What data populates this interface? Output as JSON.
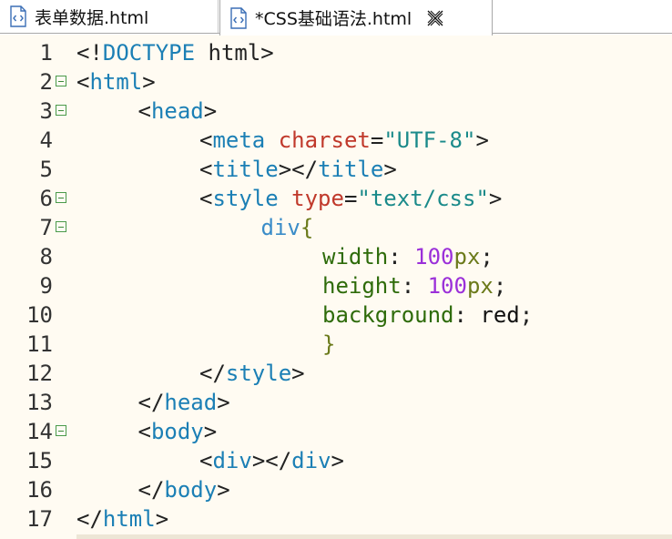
{
  "tabs": [
    {
      "label": "表单数据.html",
      "active": false,
      "icon": "html-file-icon"
    },
    {
      "label": "*CSS基础语法.html",
      "active": true,
      "icon": "html-file-icon",
      "close_icon": "close-icon"
    }
  ],
  "colors": {
    "tag": "#1b7fb5",
    "attribute": "#c0392b",
    "string": "#1a8a8a",
    "property": "#2e6b0a",
    "number": "#9b30d9",
    "unit": "#6b7a1a",
    "background": "#fffbf2"
  },
  "editor": {
    "lines": [
      {
        "num": "1",
        "fold": false,
        "indent": 0,
        "tokens": [
          [
            "punc",
            "<!"
          ],
          [
            "tag",
            "DOCTYPE"
          ],
          [
            "punc",
            " html>"
          ]
        ]
      },
      {
        "num": "2",
        "fold": true,
        "indent": 0,
        "tokens": [
          [
            "punc",
            "<"
          ],
          [
            "tag",
            "html"
          ],
          [
            "punc",
            ">"
          ]
        ]
      },
      {
        "num": "3",
        "fold": true,
        "indent": 1,
        "tokens": [
          [
            "punc",
            "<"
          ],
          [
            "tag",
            "head"
          ],
          [
            "punc",
            ">"
          ]
        ]
      },
      {
        "num": "4",
        "fold": false,
        "indent": 2,
        "tokens": [
          [
            "punc",
            "<"
          ],
          [
            "tag",
            "meta"
          ],
          [
            "punc",
            " "
          ],
          [
            "attr",
            "charset"
          ],
          [
            "punc",
            "="
          ],
          [
            "str",
            "\"UTF-8\""
          ],
          [
            "punc",
            ">"
          ]
        ]
      },
      {
        "num": "5",
        "fold": false,
        "indent": 2,
        "tokens": [
          [
            "punc",
            "<"
          ],
          [
            "tag",
            "title"
          ],
          [
            "punc",
            "></"
          ],
          [
            "tag",
            "title"
          ],
          [
            "punc",
            ">"
          ]
        ]
      },
      {
        "num": "6",
        "fold": true,
        "indent": 2,
        "tokens": [
          [
            "punc",
            "<"
          ],
          [
            "tag",
            "style"
          ],
          [
            "punc",
            " "
          ],
          [
            "attr",
            "type"
          ],
          [
            "punc",
            "="
          ],
          [
            "str",
            "\"text/css\""
          ],
          [
            "punc",
            ">"
          ]
        ]
      },
      {
        "num": "7",
        "fold": true,
        "indent": 3,
        "tokens": [
          [
            "sel",
            "div"
          ],
          [
            "brace",
            "{"
          ]
        ]
      },
      {
        "num": "8",
        "fold": false,
        "indent": 4,
        "tokens": [
          [
            "prop",
            "width"
          ],
          [
            "punc",
            ": "
          ],
          [
            "num",
            "100"
          ],
          [
            "unit",
            "px"
          ],
          [
            "punc",
            ";"
          ]
        ]
      },
      {
        "num": "9",
        "fold": false,
        "indent": 4,
        "tokens": [
          [
            "prop",
            "height"
          ],
          [
            "punc",
            ": "
          ],
          [
            "num",
            "100"
          ],
          [
            "unit",
            "px"
          ],
          [
            "punc",
            ";"
          ]
        ]
      },
      {
        "num": "10",
        "fold": false,
        "indent": 4,
        "tokens": [
          [
            "prop",
            "background"
          ],
          [
            "punc",
            ": "
          ],
          [
            "val",
            "red"
          ],
          [
            "punc",
            ";"
          ]
        ]
      },
      {
        "num": "11",
        "fold": false,
        "indent": 4,
        "tokens": [
          [
            "brace",
            "}"
          ]
        ]
      },
      {
        "num": "12",
        "fold": false,
        "indent": 2,
        "tokens": [
          [
            "punc",
            "</"
          ],
          [
            "tag",
            "style"
          ],
          [
            "punc",
            ">"
          ]
        ]
      },
      {
        "num": "13",
        "fold": false,
        "indent": 1,
        "tokens": [
          [
            "punc",
            "</"
          ],
          [
            "tag",
            "head"
          ],
          [
            "punc",
            ">"
          ]
        ]
      },
      {
        "num": "14",
        "fold": true,
        "indent": 1,
        "tokens": [
          [
            "punc",
            "<"
          ],
          [
            "tag",
            "body"
          ],
          [
            "punc",
            ">"
          ]
        ]
      },
      {
        "num": "15",
        "fold": false,
        "indent": 2,
        "tokens": [
          [
            "punc",
            "<"
          ],
          [
            "tag",
            "div"
          ],
          [
            "punc",
            "></"
          ],
          [
            "tag",
            "div"
          ],
          [
            "punc",
            ">"
          ]
        ]
      },
      {
        "num": "16",
        "fold": false,
        "indent": 1,
        "tokens": [
          [
            "punc",
            "</"
          ],
          [
            "tag",
            "body"
          ],
          [
            "punc",
            ">"
          ]
        ]
      },
      {
        "num": "17",
        "fold": false,
        "indent": 0,
        "tokens": [
          [
            "punc",
            "</"
          ],
          [
            "tag",
            "html"
          ],
          [
            "punc",
            ">"
          ]
        ]
      }
    ]
  }
}
